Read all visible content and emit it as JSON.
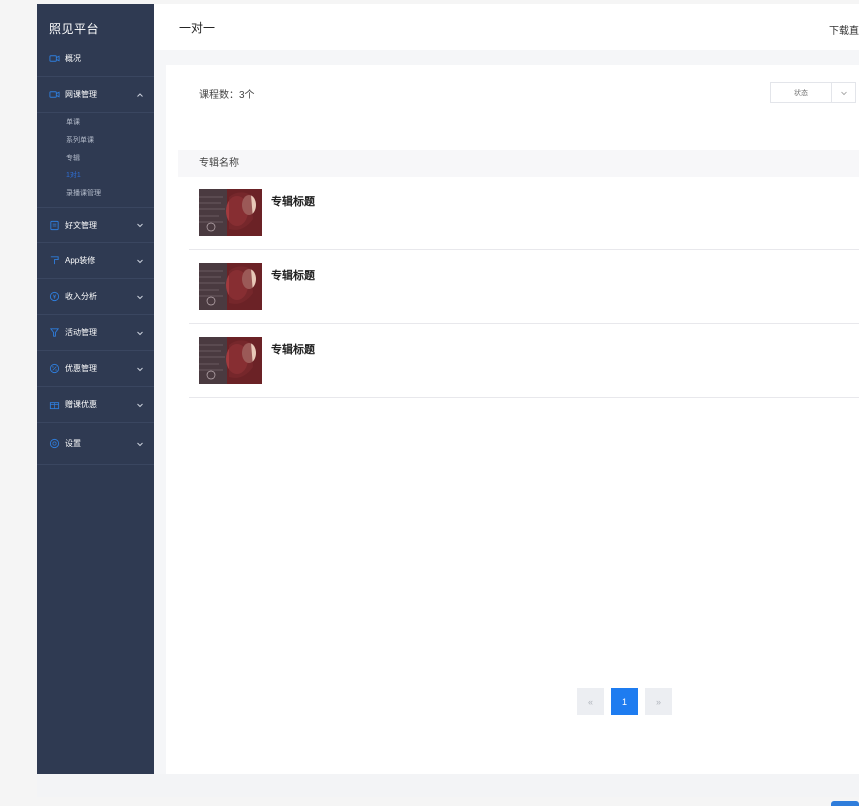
{
  "sidebar": {
    "logo": "照见平台",
    "items": [
      {
        "label": "概况",
        "icon": "video-icon"
      },
      {
        "label": "网课管理",
        "icon": "video-icon",
        "expanded": true,
        "children": [
          {
            "label": "单课"
          },
          {
            "label": "系列单课"
          },
          {
            "label": "专辑"
          },
          {
            "label": "1对1",
            "active": true
          },
          {
            "label": "录播课管理"
          }
        ]
      },
      {
        "label": "好文管理",
        "icon": "document-icon"
      },
      {
        "label": "App装修",
        "icon": "brush-icon"
      },
      {
        "label": "收入分析",
        "icon": "yuan-icon"
      },
      {
        "label": "活动管理",
        "icon": "flag-icon"
      },
      {
        "label": "优惠管理",
        "icon": "percent-icon"
      },
      {
        "label": "赠课优惠",
        "icon": "gift-icon"
      },
      {
        "label": "设置",
        "icon": "gear-icon"
      }
    ]
  },
  "header": {
    "title": "一对一",
    "download_link": "下载直"
  },
  "main": {
    "course_count": "课程数：3个",
    "status_filter": {
      "placeholder": "状态"
    },
    "table": {
      "column": "专辑名称",
      "rows": [
        {
          "title": "专辑标题"
        },
        {
          "title": "专辑标题"
        },
        {
          "title": "专辑标题"
        }
      ]
    },
    "pagination": {
      "prev": "«",
      "current": "1",
      "next": "»"
    }
  },
  "colors": {
    "sidebar_bg": "#2f3a52",
    "accent": "#1e7cf0",
    "active_sub": "#2f6fd6"
  }
}
